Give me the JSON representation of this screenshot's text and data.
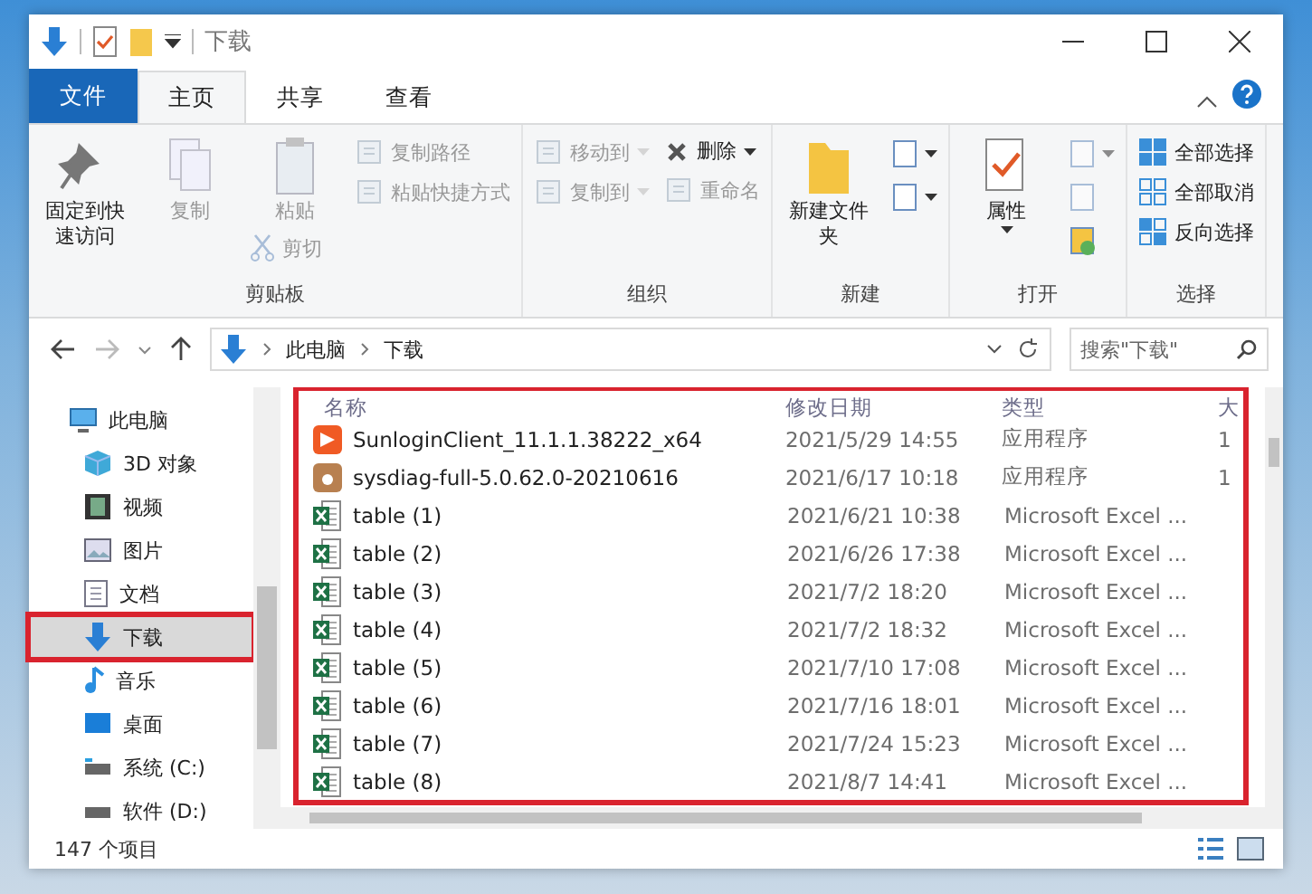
{
  "window": {
    "title": "下载"
  },
  "ribbon_tabs": [
    {
      "label": "文件",
      "kind": "file"
    },
    {
      "label": "主页",
      "selected": true
    },
    {
      "label": "共享",
      "selected": false
    },
    {
      "label": "查看",
      "selected": false
    }
  ],
  "ribbon_groups": [
    {
      "label": "剪贴板",
      "columns": [
        [
          {
            "label": "固定到快速访问",
            "kind": "large",
            "disabled": false
          }
        ],
        [
          {
            "label": "复制",
            "kind": "large",
            "disabled": true
          }
        ],
        [
          {
            "label": "粘贴",
            "kind": "large",
            "disabled": true
          },
          {
            "label": "剪切",
            "kind": "small",
            "disabled": true
          }
        ],
        [
          {
            "label": "复制路径",
            "kind": "small",
            "disabled": true
          },
          {
            "label": "粘贴快捷方式",
            "kind": "small",
            "disabled": true
          }
        ]
      ]
    },
    {
      "label": "组织",
      "columns": [
        [
          {
            "label": "移动到",
            "kind": "small",
            "disabled": true,
            "dropdown": true
          },
          {
            "label": "复制到",
            "kind": "small",
            "disabled": true,
            "dropdown": true
          }
        ],
        [
          {
            "label": "删除",
            "kind": "small",
            "disabled": false,
            "dropdown": true
          },
          {
            "label": "重命名",
            "kind": "small",
            "disabled": true
          }
        ]
      ]
    },
    {
      "label": "新建",
      "columns": [
        [
          {
            "label": "新建文件夹",
            "kind": "large",
            "disabled": false
          }
        ],
        [
          {
            "kind": "icon",
            "disabled": false,
            "dropdown": true
          },
          {
            "kind": "icon",
            "disabled": false,
            "dropdown": true
          }
        ]
      ]
    },
    {
      "label": "打开",
      "columns": [
        [
          {
            "label": "属性",
            "kind": "large",
            "disabled": false,
            "dropdown": true
          }
        ],
        [
          {
            "kind": "icon",
            "disabled": true,
            "dropdown": true
          },
          {
            "kind": "icon",
            "disabled": true
          },
          {
            "kind": "icon",
            "disabled": false
          }
        ]
      ]
    },
    {
      "label": "选择",
      "columns": [
        [
          {
            "label": "全部选择",
            "kind": "small",
            "disabled": false
          },
          {
            "label": "全部取消",
            "kind": "small",
            "disabled": false
          },
          {
            "label": "反向选择",
            "kind": "small",
            "disabled": false
          }
        ]
      ]
    }
  ],
  "address_bar": {
    "path": [
      "此电脑",
      "下载"
    ]
  },
  "search": {
    "placeholder": "搜索\"下载\""
  },
  "navigation": [
    {
      "label": "此电脑",
      "selected": false,
      "highlighted": false,
      "children": [
        {
          "label": "3D 对象",
          "selected": false,
          "highlighted": false
        },
        {
          "label": "视频",
          "selected": false,
          "highlighted": false
        },
        {
          "label": "图片",
          "selected": false,
          "highlighted": false
        },
        {
          "label": "文档",
          "selected": false,
          "highlighted": false
        },
        {
          "label": "下载",
          "selected": true,
          "highlighted": true
        },
        {
          "label": "音乐",
          "selected": false,
          "highlighted": false
        },
        {
          "label": "桌面",
          "selected": false,
          "highlighted": false
        },
        {
          "label": "系统 (C:)",
          "selected": false,
          "highlighted": false
        },
        {
          "label": "软件 (D:)",
          "selected": false,
          "highlighted": false
        }
      ]
    }
  ],
  "file_list": {
    "highlighted": true,
    "columns": [
      "名称",
      "修改日期",
      "类型",
      "大"
    ],
    "rows": [
      {
        "kind": "app",
        "name": "SunloginClient_11.1.1.38222_x64",
        "date": "2021/5/29 14:55",
        "type": "应用程序",
        "size": "1"
      },
      {
        "kind": "installer",
        "name": "sysdiag-full-5.0.62.0-20210616",
        "date": "2021/6/17 10:18",
        "type": "应用程序",
        "size": "1"
      },
      {
        "kind": "spreadsheet",
        "name": "table (1)",
        "date": "2021/6/21 10:38",
        "type": "Microsoft Excel ..."
      },
      {
        "kind": "spreadsheet",
        "name": "table (2)",
        "date": "2021/6/26 17:38",
        "type": "Microsoft Excel ..."
      },
      {
        "kind": "spreadsheet",
        "name": "table (3)",
        "date": "2021/7/2 18:20",
        "type": "Microsoft Excel ..."
      },
      {
        "kind": "spreadsheet",
        "name": "table (4)",
        "date": "2021/7/2 18:32",
        "type": "Microsoft Excel ..."
      },
      {
        "kind": "spreadsheet",
        "name": "table (5)",
        "date": "2021/7/10 17:08",
        "type": "Microsoft Excel ..."
      },
      {
        "kind": "spreadsheet",
        "name": "table (6)",
        "date": "2021/7/16 18:01",
        "type": "Microsoft Excel ..."
      },
      {
        "kind": "spreadsheet",
        "name": "table (7)",
        "date": "2021/7/24 15:23",
        "type": "Microsoft Excel ..."
      },
      {
        "kind": "spreadsheet",
        "name": "table (8)",
        "date": "2021/8/7 14:41",
        "type": "Microsoft Excel ..."
      }
    ]
  },
  "status_bar": {
    "item_count": "147 个项目"
  }
}
